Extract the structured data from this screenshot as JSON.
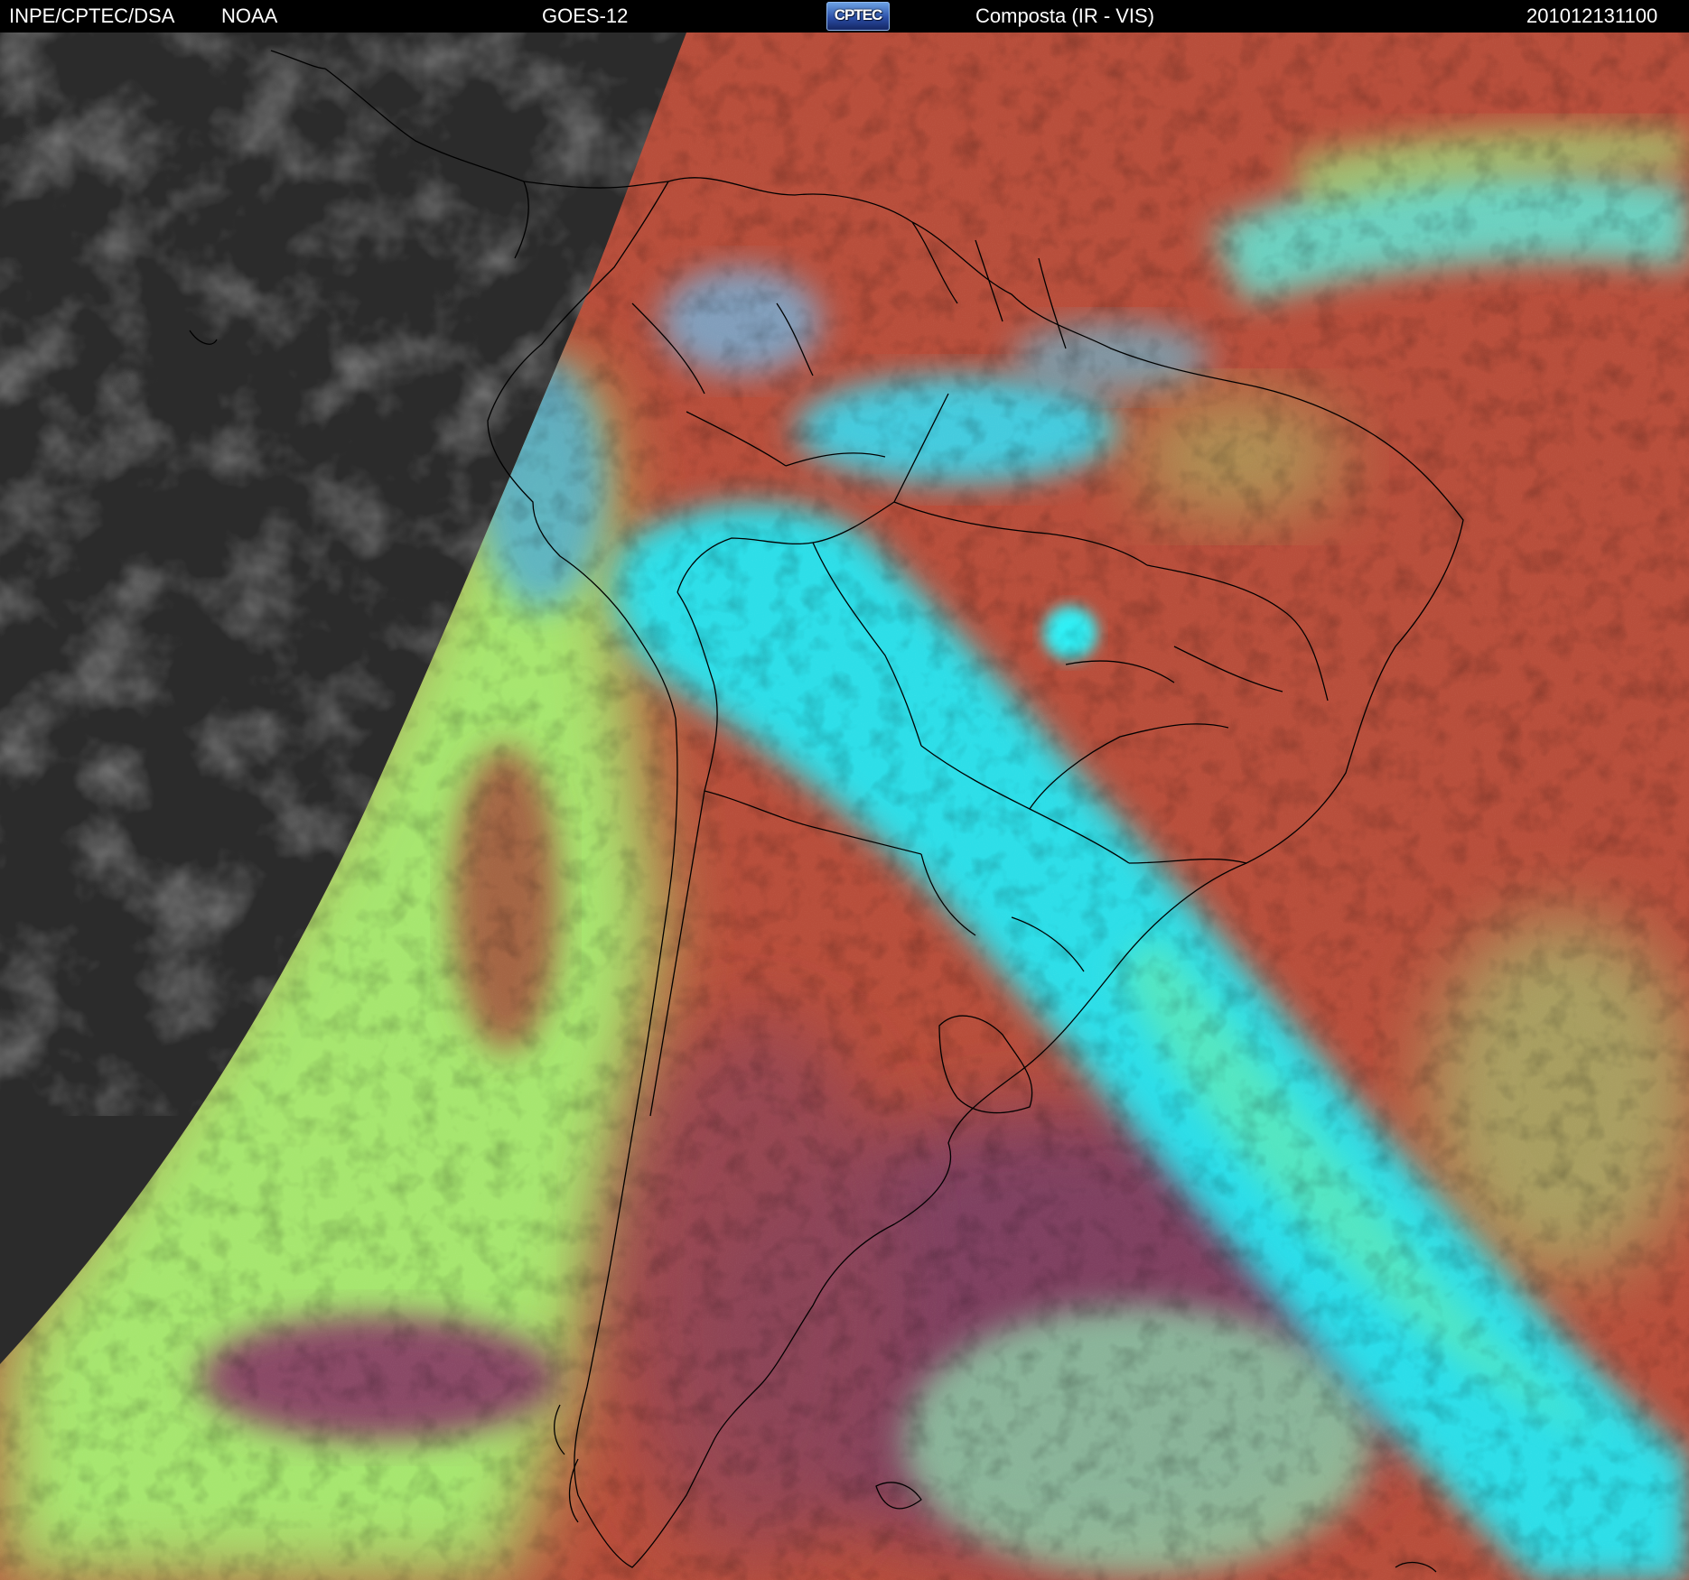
{
  "header": {
    "organization": "INPE/CPTEC/DSA",
    "agency": "NOAA",
    "satellite": "GOES-12",
    "logo_text": "CPTEC",
    "product": "Composta (IR - VIS)",
    "timestamp": "201012131100"
  },
  "colors": {
    "night_gray": "#2b2b2b",
    "land_red": "#b24a3c",
    "ocean_red": "#b84e3b",
    "cloud_cyan": "#27e6f2",
    "low_cloud_green": "#a6ef72",
    "deep_purple": "#7d3f62",
    "border_line": "#000000"
  }
}
